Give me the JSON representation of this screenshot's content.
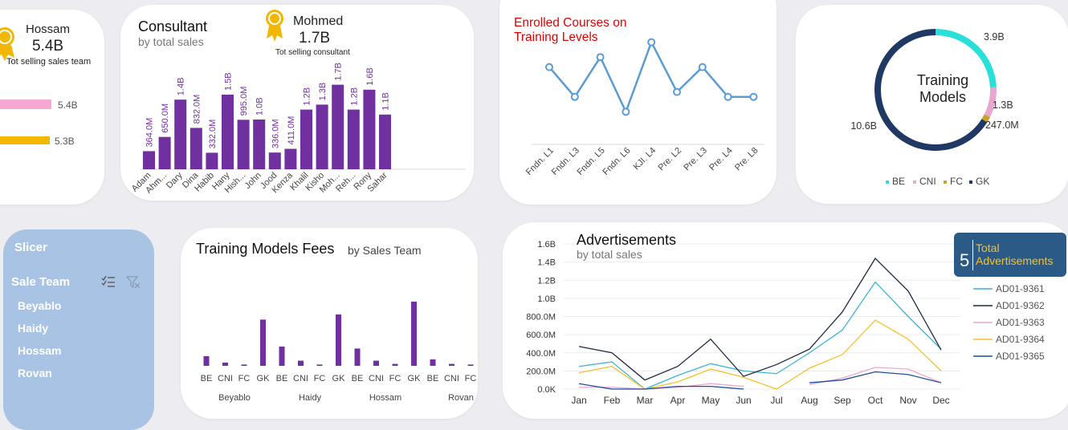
{
  "team_card": {
    "top_name": "Hossam",
    "top_value": "5.4B",
    "caption": "Tot selling sales team",
    "bars": [
      {
        "value": 5.4,
        "label": "5.4B",
        "color": "#f5a9d0"
      },
      {
        "value": 5.3,
        "label": "5.3B",
        "color": "#f5b800"
      }
    ]
  },
  "consultant_card": {
    "title": "Consultant",
    "subtitle": "by total sales",
    "top_name": "Mohmed",
    "top_value": "1.7B",
    "caption": "Tot selling consultant"
  },
  "courses_card": {
    "title_line1": "Enrolled Courses on",
    "title_line2": "Training Levels"
  },
  "models_card": {
    "center_line1": "Training",
    "center_line2": "Models"
  },
  "slicer": {
    "title": "Slicer",
    "field_label": "Sale Team",
    "items": [
      "Beyablo",
      "Haidy",
      "Hossam",
      "Rovan"
    ]
  },
  "fees_card": {
    "title": "Training Models Fees",
    "subtitle": "by Sales Team"
  },
  "ads_card": {
    "title": "Advertisements",
    "subtitle": "by total sales",
    "badge_number": "5",
    "badge_label_line1": "Total",
    "badge_label_line2": "Advertisements"
  },
  "chart_data": [
    {
      "id": "consultant",
      "type": "bar",
      "color": "#7030a0",
      "categories": [
        "Adam",
        "Ahm...",
        "Dary",
        "Dina",
        "Habib",
        "Hany",
        "Hish...",
        "John",
        "Jood",
        "Kenza",
        "Khalil",
        "Kisho",
        "Moh...",
        "Reh...",
        "Rony",
        "Sahar"
      ],
      "values": [
        0.364,
        0.65,
        1.4,
        0.832,
        0.332,
        1.5,
        0.995,
        1.0,
        0.336,
        0.411,
        1.2,
        1.3,
        1.7,
        1.2,
        1.6,
        1.1
      ],
      "labels": [
        "364.0M",
        "650.0M",
        "1.4B",
        "832.0M",
        "332.0M",
        "1.5B",
        "995.0M",
        "1.0B",
        "336.0M",
        "411.0M",
        "1.2B",
        "1.3B",
        "1.7B",
        "1.2B",
        "1.6B",
        "1.1B"
      ]
    },
    {
      "id": "courses",
      "type": "line",
      "color": "#5b9bd5",
      "categories": [
        "Fndn. L1",
        "Fndn. L3",
        "Fndn. L5",
        "Fndn. L6",
        "KJI. L4",
        "Pre. L2",
        "Pre. L3",
        "Pre. L4",
        "Pre. L8"
      ],
      "values": [
        6,
        3,
        7,
        1.5,
        8.5,
        3.5,
        6,
        3,
        3
      ]
    },
    {
      "id": "models",
      "type": "pie",
      "style": "donut",
      "categories": [
        "BE",
        "CNI",
        "FC",
        "GK"
      ],
      "values": [
        3.9,
        1.3,
        0.247,
        10.6
      ],
      "labels": [
        "3.9B",
        "1.3B",
        "247.0M",
        "10.6B"
      ],
      "colors": [
        "#29e0d8",
        "#e8a7cf",
        "#c9a227",
        "#1f3864"
      ],
      "legend": "bottom"
    },
    {
      "id": "fees",
      "type": "bar",
      "color": "#7030a0",
      "groups": [
        "Beyablo",
        "Haidy",
        "Hossam",
        "Rovan"
      ],
      "categories": [
        "BE",
        "CNI",
        "FC",
        "GK"
      ],
      "values": [
        [
          15,
          5,
          2,
          72
        ],
        [
          30,
          8,
          2,
          80
        ],
        [
          27,
          8,
          3,
          100
        ],
        [
          10,
          3,
          2,
          40
        ]
      ],
      "group_peaks": [
        36,
        30,
        26,
        75
      ]
    },
    {
      "id": "ads",
      "type": "line",
      "categories": [
        "Jan",
        "Feb",
        "Mar",
        "Apr",
        "May",
        "Jun",
        "Jul",
        "Aug",
        "Sep",
        "Oct",
        "Nov",
        "Dec"
      ],
      "ylim": [
        0,
        1.6
      ],
      "yticks": [
        "0.0K",
        "200.0M",
        "400.0M",
        "600.0M",
        "800.0M",
        "1.0B",
        "1.2B",
        "1.4B",
        "1.6B"
      ],
      "legend": "right",
      "series": [
        {
          "name": "AD01-9361",
          "color": "#3bb4d8",
          "values": [
            0.25,
            0.3,
            0.0,
            0.15,
            0.28,
            0.2,
            0.17,
            0.4,
            0.65,
            1.18,
            0.8,
            0.44
          ]
        },
        {
          "name": "AD01-9362",
          "color": "#1f2a44",
          "values": [
            0.47,
            0.4,
            0.1,
            0.25,
            0.55,
            0.14,
            0.27,
            0.44,
            0.85,
            1.44,
            1.08,
            0.43
          ]
        },
        {
          "name": "AD01-9363",
          "color": "#e8a7cf",
          "values": [
            0.02,
            0.02,
            0.0,
            0.02,
            0.06,
            0.03,
            null,
            0.05,
            0.12,
            0.24,
            0.22,
            0.07
          ]
        },
        {
          "name": "AD01-9364",
          "color": "#f5c12e",
          "values": [
            0.18,
            0.25,
            0.0,
            0.08,
            0.22,
            0.13,
            0.0,
            0.23,
            0.38,
            0.76,
            0.55,
            0.2
          ]
        },
        {
          "name": "AD01-9365",
          "color": "#1f4e9a",
          "values": [
            0.06,
            0.0,
            0.0,
            0.03,
            0.03,
            0.0,
            null,
            0.07,
            0.1,
            0.19,
            0.16,
            0.07
          ]
        }
      ]
    }
  ]
}
